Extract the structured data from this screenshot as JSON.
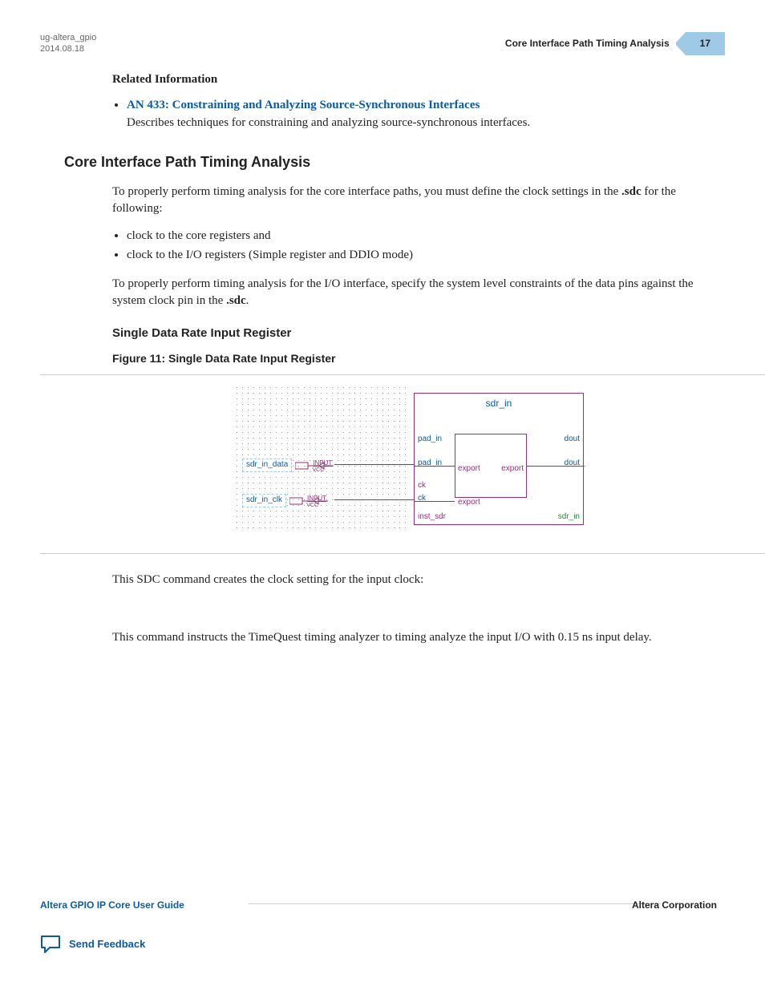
{
  "header": {
    "doc_id": "ug-altera_gpio",
    "date": "2014.08.18",
    "section_title": "Core Interface Path Timing Analysis",
    "page_number": "17"
  },
  "related_info": {
    "heading": "Related Information",
    "link_text": "AN 433: Constraining and Analyzing Source-Synchronous Interfaces",
    "link_desc": "Describes techniques for constraining and analyzing source-synchronous interfaces."
  },
  "section": {
    "title": "Core Interface Path Timing Analysis",
    "intro_pre": "To properly perform timing analysis for the core interface paths, you must define the clock settings in the ",
    "intro_bold": ".sdc",
    "intro_post": " for the following:",
    "bullets": [
      "clock to the core registers and",
      "clock to the I/O registers (Simple register and DDIO mode)"
    ],
    "para2_pre": "To properly perform timing analysis for the I/O interface, specify the system level constraints of the data pins against the system clock pin in the ",
    "para2_bold": ".sdc",
    "para2_post": "."
  },
  "subsection": {
    "title": "Single Data Rate Input Register",
    "figure_caption": "Figure 11: Single Data Rate Input Register"
  },
  "diagram": {
    "block_title": "sdr_in",
    "pin_data": "sdr_in_data",
    "pin_clk": "sdr_in_clk",
    "input_label": "INPUT",
    "vcc_label": "VCC",
    "pad_in_outer": "pad_in",
    "pad_in_inner": "pad_in",
    "dout_outer": "dout",
    "dout_inner": "dout",
    "ck_outer": "ck",
    "ck_inner": "ck",
    "export1": "export",
    "export2": "export",
    "export3": "export",
    "inst_label": "inst_sdr",
    "inst_type": "sdr_in"
  },
  "post_figure": {
    "p1": "This SDC command creates the clock setting for the input clock:",
    "p2": "This command instructs the TimeQuest timing analyzer to timing analyze the input I/O with 0.15 ns input delay."
  },
  "footer": {
    "guide": "Altera GPIO IP Core User Guide",
    "corp": "Altera Corporation",
    "feedback": "Send Feedback"
  }
}
